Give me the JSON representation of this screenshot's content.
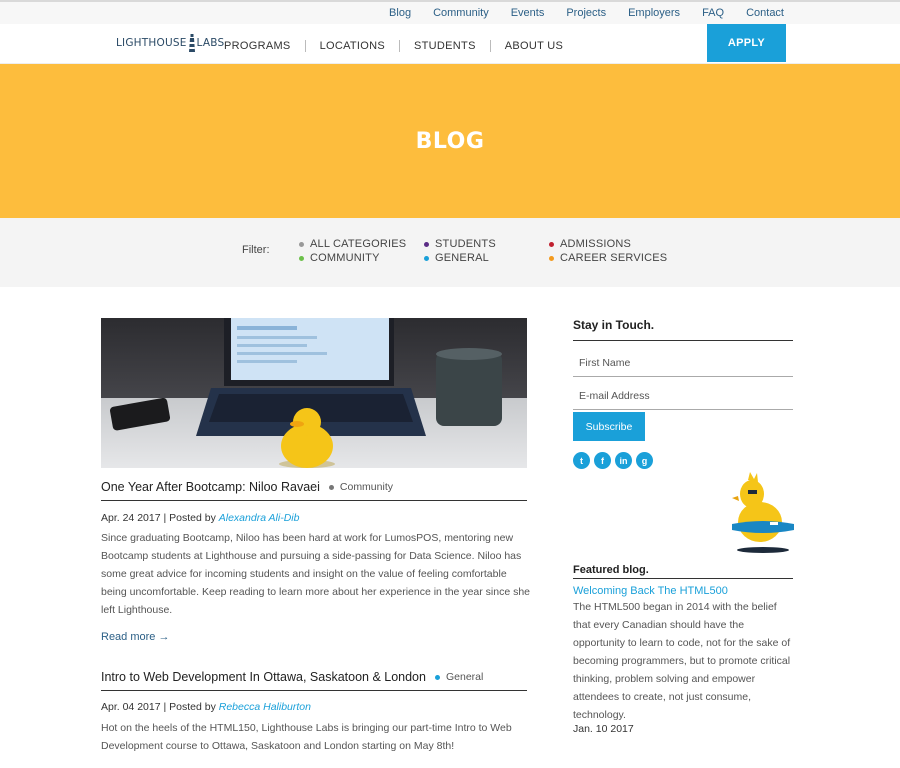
{
  "topbar": {
    "links": [
      "Blog",
      "Community",
      "Events",
      "Projects",
      "Employers",
      "FAQ",
      "Contact"
    ]
  },
  "nav": {
    "logo_left": "LIGHTHOUSE",
    "logo_right": "LABS",
    "items": [
      "PROGRAMS",
      "LOCATIONS",
      "STUDENTS",
      "ABOUT US"
    ],
    "apply": "APPLY"
  },
  "hero": {
    "title": "BLOG"
  },
  "filter": {
    "label": "Filter:",
    "categories": [
      {
        "label": "ALL CATEGORIES",
        "color": "#999999"
      },
      {
        "label": "COMMUNITY",
        "color": "#6cc04a"
      },
      {
        "label": "STUDENTS",
        "color": "#5b2c86"
      },
      {
        "label": "GENERAL",
        "color": "#1aa0d9"
      },
      {
        "label": "ADMISSIONS",
        "color": "#c0202f"
      },
      {
        "label": "CAREER SERVICES",
        "color": "#f39a1e"
      }
    ]
  },
  "posts": [
    {
      "title": "One Year After Bootcamp: Niloo Ravaei",
      "category": "Community",
      "category_color": "#777777",
      "date": "Apr. 24 2017",
      "posted_by": "| Posted by",
      "author": "Alexandra Ali-Dib",
      "excerpt": "Since graduating Bootcamp, Niloo has been hard at work for LumosPOS, mentoring new Bootcamp students at Lighthouse and pursuing a side-passing for Data Science. Niloo has some great advice for incoming students and insight on the value of feeling comfortable being uncomfortable. Keep reading to learn more about her experience in the year since she left Lighthouse.",
      "read_more": "Read more"
    },
    {
      "title": "Intro to Web Development In Ottawa, Saskatoon & London",
      "category": "General",
      "category_color": "#1aa0d9",
      "date": "Apr. 04 2017",
      "posted_by": "| Posted by",
      "author": "Rebecca Haliburton",
      "excerpt": "Hot on the heels of the HTML150, Lighthouse Labs is bringing our part-time Intro to Web Development course to Ottawa, Saskatoon and London starting on May 8th!"
    }
  ],
  "sidebar": {
    "stay_title": "Stay in Touch.",
    "first_name_placeholder": "First Name",
    "email_placeholder": "E-mail Address",
    "subscribe": "Subscribe",
    "social": [
      "twitter-icon",
      "facebook-icon",
      "linkedin-icon",
      "google-plus-icon"
    ],
    "featured_label": "Featured blog.",
    "featured_title": "Welcoming Back The HTML500",
    "featured_body": "The HTML500 began in 2014 with the belief that every Canadian should have the opportunity to learn to code, not for the sake of becoming programmers, but to promote critical thinking, problem solving and empower attendees to create, not just consume, technology.",
    "featured_date": "Jan. 10 2017"
  }
}
